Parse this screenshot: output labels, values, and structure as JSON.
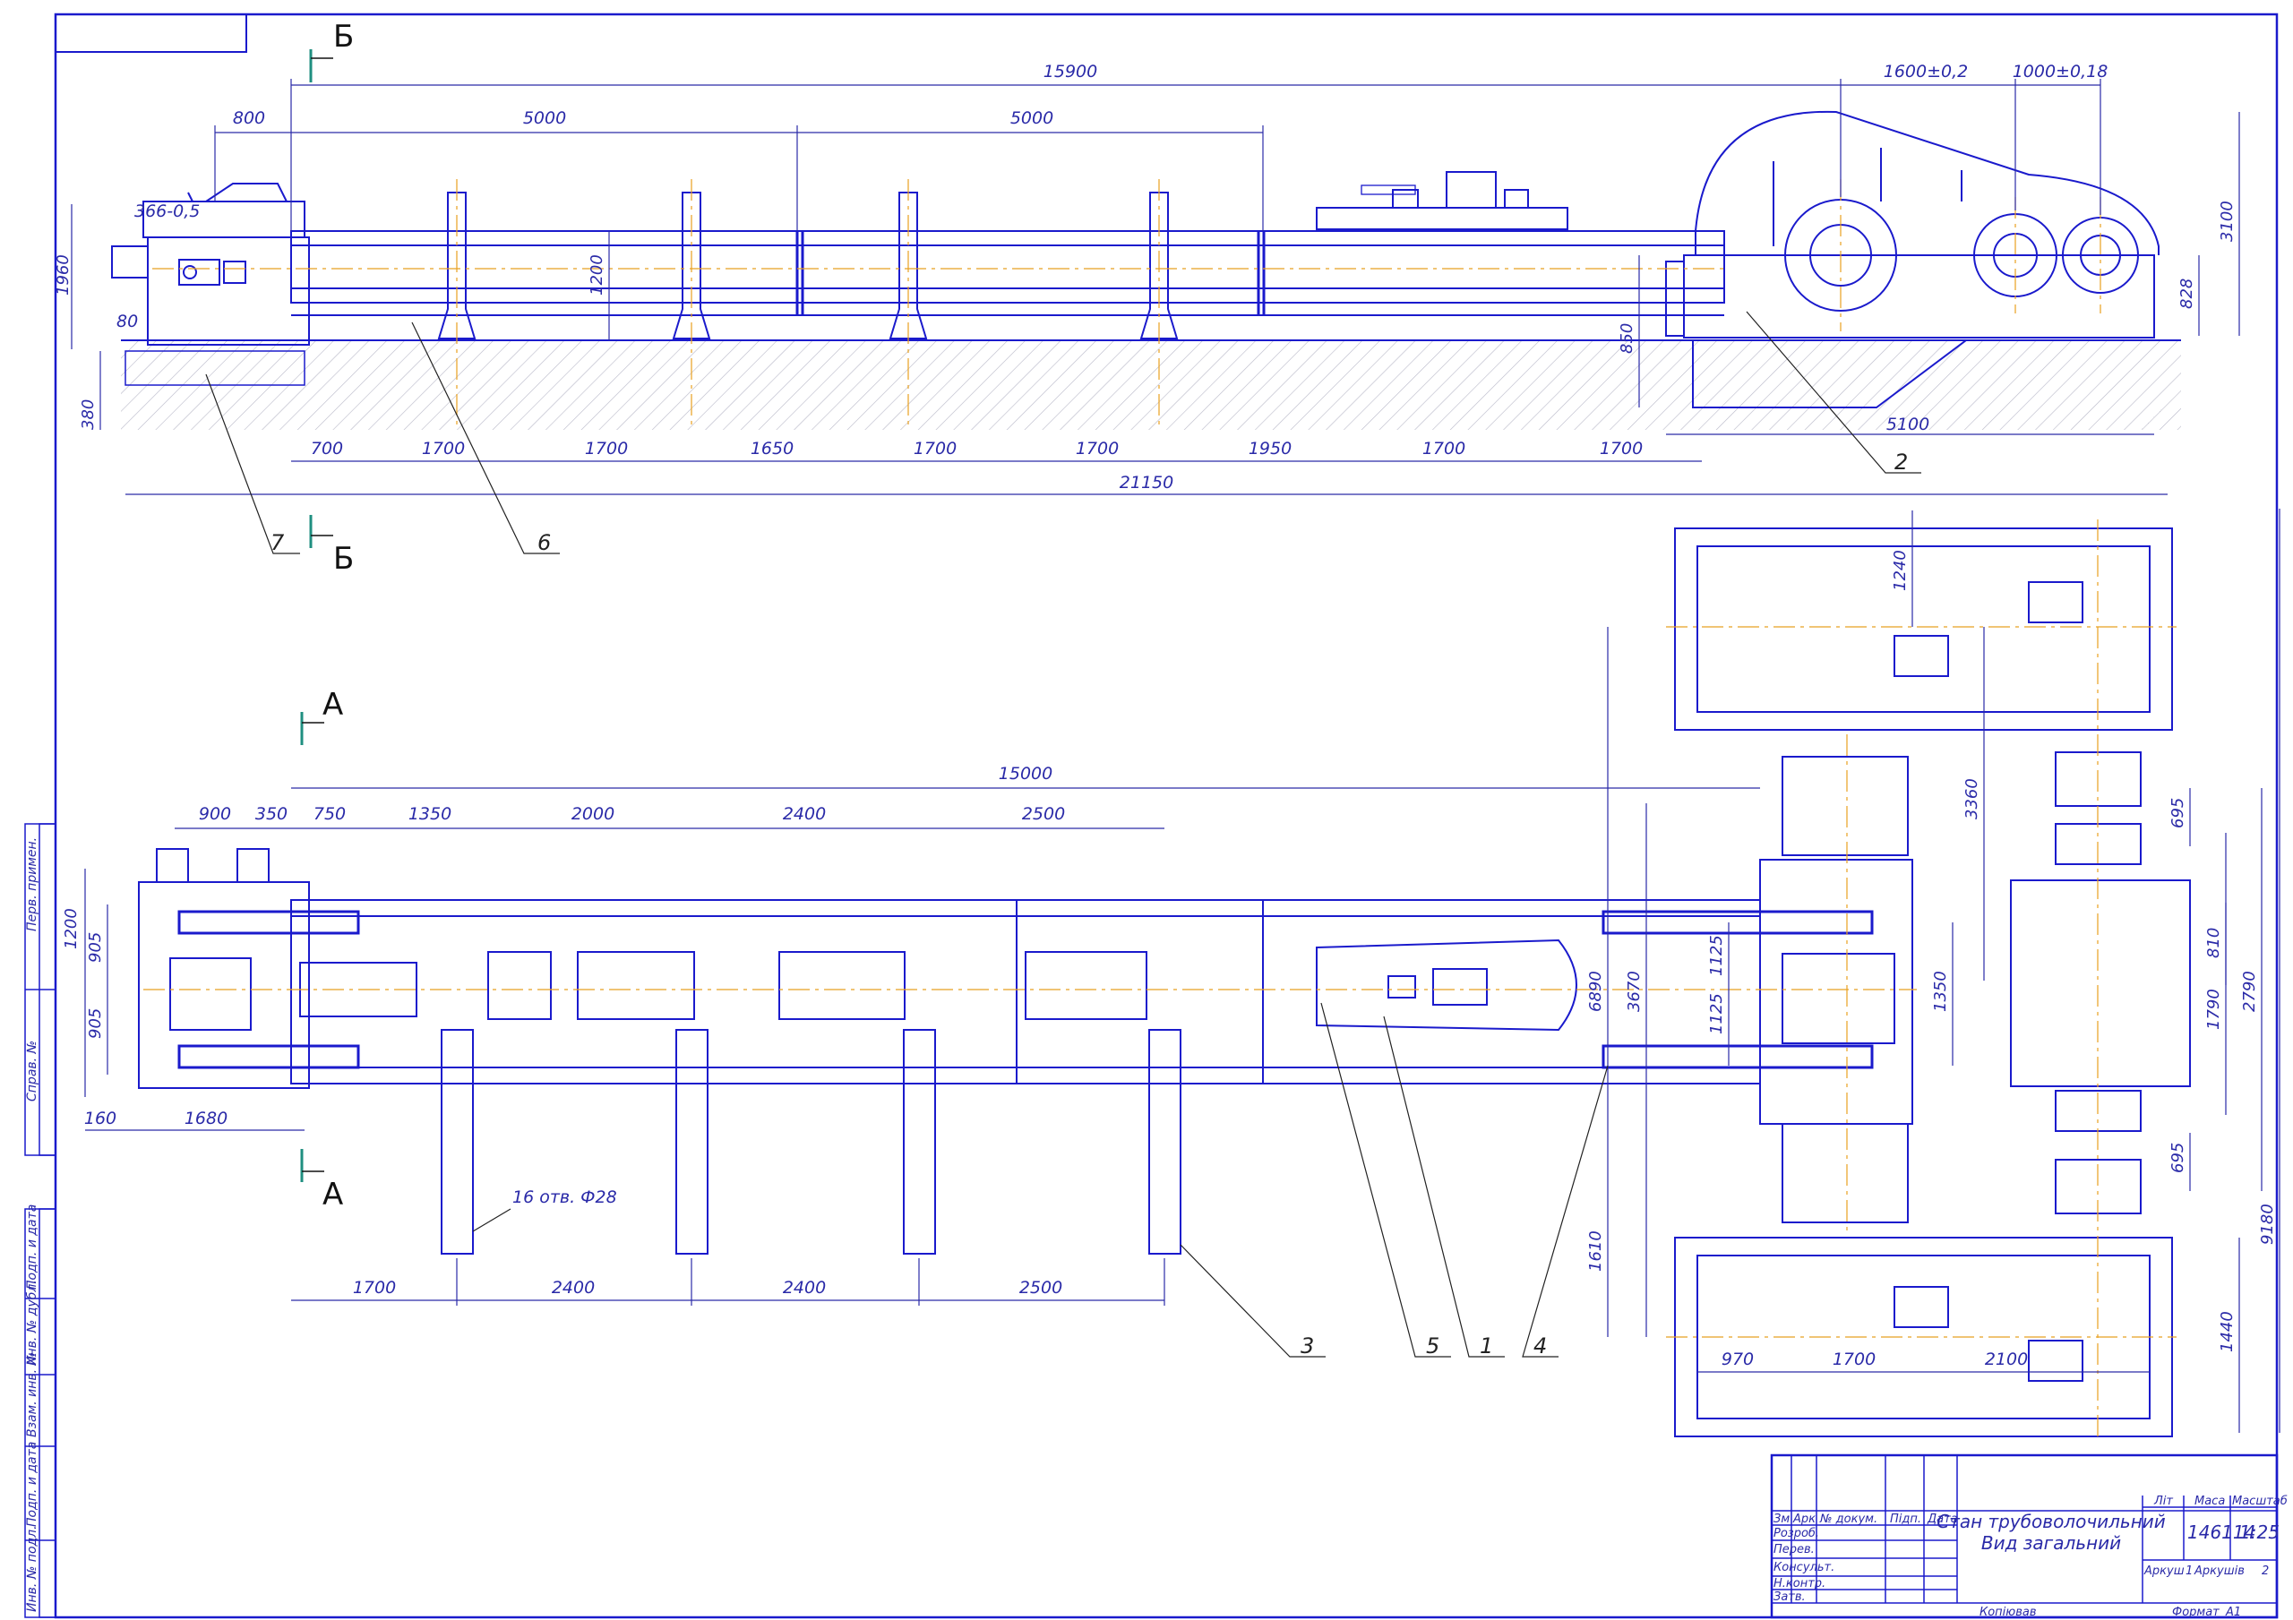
{
  "colors": {
    "line": "#1a1acc",
    "dim": "#2a2aa8",
    "center": "#e8a020",
    "section_mark": "#1f8f80",
    "hatch": "#b8b8c8"
  },
  "section_marks": {
    "b_top": "Б",
    "b_bottom": "Б",
    "a_top": "А",
    "a_bottom": "А"
  },
  "elevation": {
    "dims": {
      "overall_top": "15900",
      "gear_a": "1600±0,2",
      "gear_b": "1000±0,18",
      "d800": "800",
      "d5000_a": "5000",
      "d5000_b": "5000",
      "d366": "366-0,5",
      "d1960": "1960",
      "d80": "80",
      "d380": "380",
      "d1200": "1200",
      "d850": "850",
      "d3100": "3100",
      "d828": "828",
      "d5100": "5100",
      "overall_bottom": "21150"
    },
    "bottom_dims": [
      "700",
      "1700",
      "1700",
      "1650",
      "1700",
      "1700",
      "1950",
      "1700",
      "1700"
    ],
    "labels": {
      "p7": "7",
      "p6": "6",
      "p2": "2"
    }
  },
  "plan": {
    "dims": {
      "overall": "15000",
      "d900": "900",
      "d350": "350",
      "d1200": "1200",
      "d905_a": "905",
      "d905_b": "905",
      "d160": "160",
      "d1680": "1680",
      "holes": "16 отв. Ф28",
      "d6890": "6890",
      "d3670": "3670",
      "d1125_a": "1125",
      "d1125_b": "1125",
      "d1350": "1350",
      "d1610": "1610",
      "d3360": "3360",
      "d1240": "1240",
      "d695_a": "695",
      "d695_b": "695",
      "d810": "810",
      "d1790": "1790",
      "d2790": "2790",
      "d9180": "9180",
      "d1440": "1440",
      "d970": "970",
      "d1700": "1700",
      "d2100": "2100"
    },
    "top_dims": [
      "750",
      "1350",
      "2000",
      "2400",
      "2500"
    ],
    "bottom_dims": [
      "1700",
      "2400",
      "2400",
      "2500"
    ],
    "labels": {
      "p3": "3",
      "p5": "5",
      "p1": "1",
      "p4": "4"
    }
  },
  "side_stamp": [
    "Перв. примен.",
    "Справ. №",
    "Подп. и дата",
    "Инв. № дубл.",
    "Взам. инв. №",
    "Подп. и дата",
    "Инв. № подл."
  ],
  "title_block": {
    "title_line1": "Стан трубоволочильний",
    "title_line2": "Вид загальний",
    "col_izm": "Зм",
    "col_ark": "Арк",
    "col_doc": "№ докум.",
    "col_sign": "Підп.",
    "col_date": "Дата",
    "row_razrob": "Розроб.",
    "row_perev": "Перев.",
    "row_konsult": "Консульт.",
    "row_nkontr": "Н.контр.",
    "row_zatv": "Затв.",
    "lit": "Літ",
    "mass": "Маса",
    "scale": "Масштаб",
    "mass_value": "146114",
    "scale_value": "1:25",
    "sheet": "Аркуш",
    "sheet_no": "1",
    "sheets": "Аркушів",
    "sheets_no": "2",
    "copied": "Копіював",
    "format": "Формат",
    "format_value": "А1"
  }
}
